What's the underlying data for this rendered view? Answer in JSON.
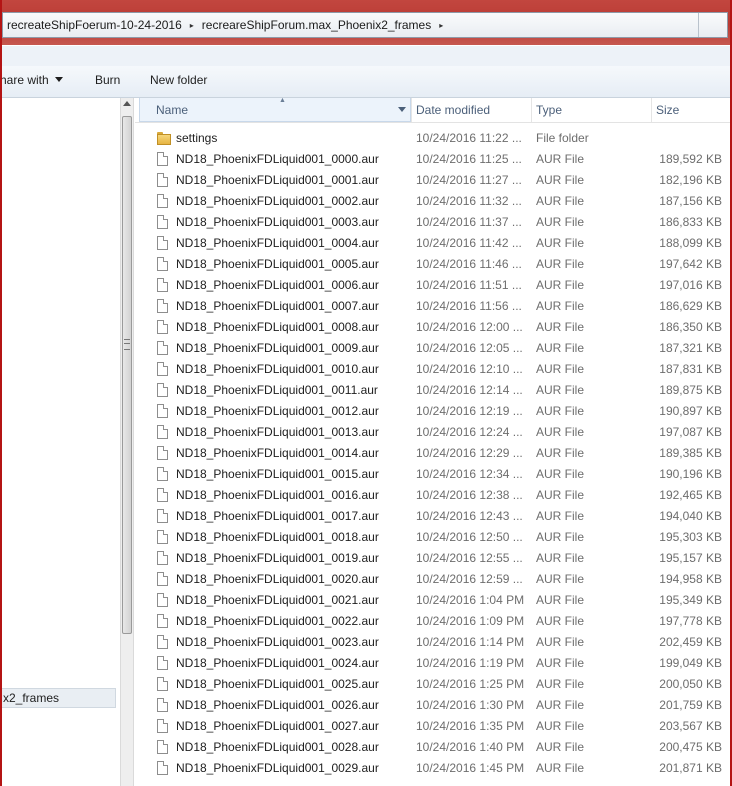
{
  "address": {
    "crumbs": [
      "recreateShipFoerum-10-24-2016",
      "recreareShipForum.max_Phoenix2_frames"
    ],
    "separator": "▸"
  },
  "toolbar": {
    "share_label": "hare with",
    "burn_label": "Burn",
    "new_folder_label": "New folder"
  },
  "nav": {
    "selected_item": "x2_frames"
  },
  "columns": {
    "name": "Name",
    "date": "Date modified",
    "type": "Type",
    "size": "Size"
  },
  "files": [
    {
      "icon": "folder-icon",
      "name": "settings",
      "date": "10/24/2016 11:22 ...",
      "type": "File folder",
      "size": ""
    },
    {
      "icon": "file-icon",
      "name": "ND18_PhoenixFDLiquid001_0000.aur",
      "date": "10/24/2016 11:25 ...",
      "type": "AUR File",
      "size": "189,592 KB"
    },
    {
      "icon": "file-icon",
      "name": "ND18_PhoenixFDLiquid001_0001.aur",
      "date": "10/24/2016 11:27 ...",
      "type": "AUR File",
      "size": "182,196 KB"
    },
    {
      "icon": "file-icon",
      "name": "ND18_PhoenixFDLiquid001_0002.aur",
      "date": "10/24/2016 11:32 ...",
      "type": "AUR File",
      "size": "187,156 KB"
    },
    {
      "icon": "file-icon",
      "name": "ND18_PhoenixFDLiquid001_0003.aur",
      "date": "10/24/2016 11:37 ...",
      "type": "AUR File",
      "size": "186,833 KB"
    },
    {
      "icon": "file-icon",
      "name": "ND18_PhoenixFDLiquid001_0004.aur",
      "date": "10/24/2016 11:42 ...",
      "type": "AUR File",
      "size": "188,099 KB"
    },
    {
      "icon": "file-icon",
      "name": "ND18_PhoenixFDLiquid001_0005.aur",
      "date": "10/24/2016 11:46 ...",
      "type": "AUR File",
      "size": "197,642 KB"
    },
    {
      "icon": "file-icon",
      "name": "ND18_PhoenixFDLiquid001_0006.aur",
      "date": "10/24/2016 11:51 ...",
      "type": "AUR File",
      "size": "197,016 KB"
    },
    {
      "icon": "file-icon",
      "name": "ND18_PhoenixFDLiquid001_0007.aur",
      "date": "10/24/2016 11:56 ...",
      "type": "AUR File",
      "size": "186,629 KB"
    },
    {
      "icon": "file-icon",
      "name": "ND18_PhoenixFDLiquid001_0008.aur",
      "date": "10/24/2016 12:00 ...",
      "type": "AUR File",
      "size": "186,350 KB"
    },
    {
      "icon": "file-icon",
      "name": "ND18_PhoenixFDLiquid001_0009.aur",
      "date": "10/24/2016 12:05 ...",
      "type": "AUR File",
      "size": "187,321 KB"
    },
    {
      "icon": "file-icon",
      "name": "ND18_PhoenixFDLiquid001_0010.aur",
      "date": "10/24/2016 12:10 ...",
      "type": "AUR File",
      "size": "187,831 KB"
    },
    {
      "icon": "file-icon",
      "name": "ND18_PhoenixFDLiquid001_0011.aur",
      "date": "10/24/2016 12:14 ...",
      "type": "AUR File",
      "size": "189,875 KB"
    },
    {
      "icon": "file-icon",
      "name": "ND18_PhoenixFDLiquid001_0012.aur",
      "date": "10/24/2016 12:19 ...",
      "type": "AUR File",
      "size": "190,897 KB"
    },
    {
      "icon": "file-icon",
      "name": "ND18_PhoenixFDLiquid001_0013.aur",
      "date": "10/24/2016 12:24 ...",
      "type": "AUR File",
      "size": "197,087 KB"
    },
    {
      "icon": "file-icon",
      "name": "ND18_PhoenixFDLiquid001_0014.aur",
      "date": "10/24/2016 12:29 ...",
      "type": "AUR File",
      "size": "189,385 KB"
    },
    {
      "icon": "file-icon",
      "name": "ND18_PhoenixFDLiquid001_0015.aur",
      "date": "10/24/2016 12:34 ...",
      "type": "AUR File",
      "size": "190,196 KB"
    },
    {
      "icon": "file-icon",
      "name": "ND18_PhoenixFDLiquid001_0016.aur",
      "date": "10/24/2016 12:38 ...",
      "type": "AUR File",
      "size": "192,465 KB"
    },
    {
      "icon": "file-icon",
      "name": "ND18_PhoenixFDLiquid001_0017.aur",
      "date": "10/24/2016 12:43 ...",
      "type": "AUR File",
      "size": "194,040 KB"
    },
    {
      "icon": "file-icon",
      "name": "ND18_PhoenixFDLiquid001_0018.aur",
      "date": "10/24/2016 12:50 ...",
      "type": "AUR File",
      "size": "195,303 KB"
    },
    {
      "icon": "file-icon",
      "name": "ND18_PhoenixFDLiquid001_0019.aur",
      "date": "10/24/2016 12:55 ...",
      "type": "AUR File",
      "size": "195,157 KB"
    },
    {
      "icon": "file-icon",
      "name": "ND18_PhoenixFDLiquid001_0020.aur",
      "date": "10/24/2016 12:59 ...",
      "type": "AUR File",
      "size": "194,958 KB"
    },
    {
      "icon": "file-icon",
      "name": "ND18_PhoenixFDLiquid001_0021.aur",
      "date": "10/24/2016 1:04 PM",
      "type": "AUR File",
      "size": "195,349 KB"
    },
    {
      "icon": "file-icon",
      "name": "ND18_PhoenixFDLiquid001_0022.aur",
      "date": "10/24/2016 1:09 PM",
      "type": "AUR File",
      "size": "197,778 KB"
    },
    {
      "icon": "file-icon",
      "name": "ND18_PhoenixFDLiquid001_0023.aur",
      "date": "10/24/2016 1:14 PM",
      "type": "AUR File",
      "size": "202,459 KB"
    },
    {
      "icon": "file-icon",
      "name": "ND18_PhoenixFDLiquid001_0024.aur",
      "date": "10/24/2016 1:19 PM",
      "type": "AUR File",
      "size": "199,049 KB"
    },
    {
      "icon": "file-icon",
      "name": "ND18_PhoenixFDLiquid001_0025.aur",
      "date": "10/24/2016 1:25 PM",
      "type": "AUR File",
      "size": "200,050 KB"
    },
    {
      "icon": "file-icon",
      "name": "ND18_PhoenixFDLiquid001_0026.aur",
      "date": "10/24/2016 1:30 PM",
      "type": "AUR File",
      "size": "201,759 KB"
    },
    {
      "icon": "file-icon",
      "name": "ND18_PhoenixFDLiquid001_0027.aur",
      "date": "10/24/2016 1:35 PM",
      "type": "AUR File",
      "size": "203,567 KB"
    },
    {
      "icon": "file-icon",
      "name": "ND18_PhoenixFDLiquid001_0028.aur",
      "date": "10/24/2016 1:40 PM",
      "type": "AUR File",
      "size": "200,475 KB"
    },
    {
      "icon": "file-icon",
      "name": "ND18_PhoenixFDLiquid001_0029.aur",
      "date": "10/24/2016 1:45 PM",
      "type": "AUR File",
      "size": "201,871 KB"
    }
  ]
}
